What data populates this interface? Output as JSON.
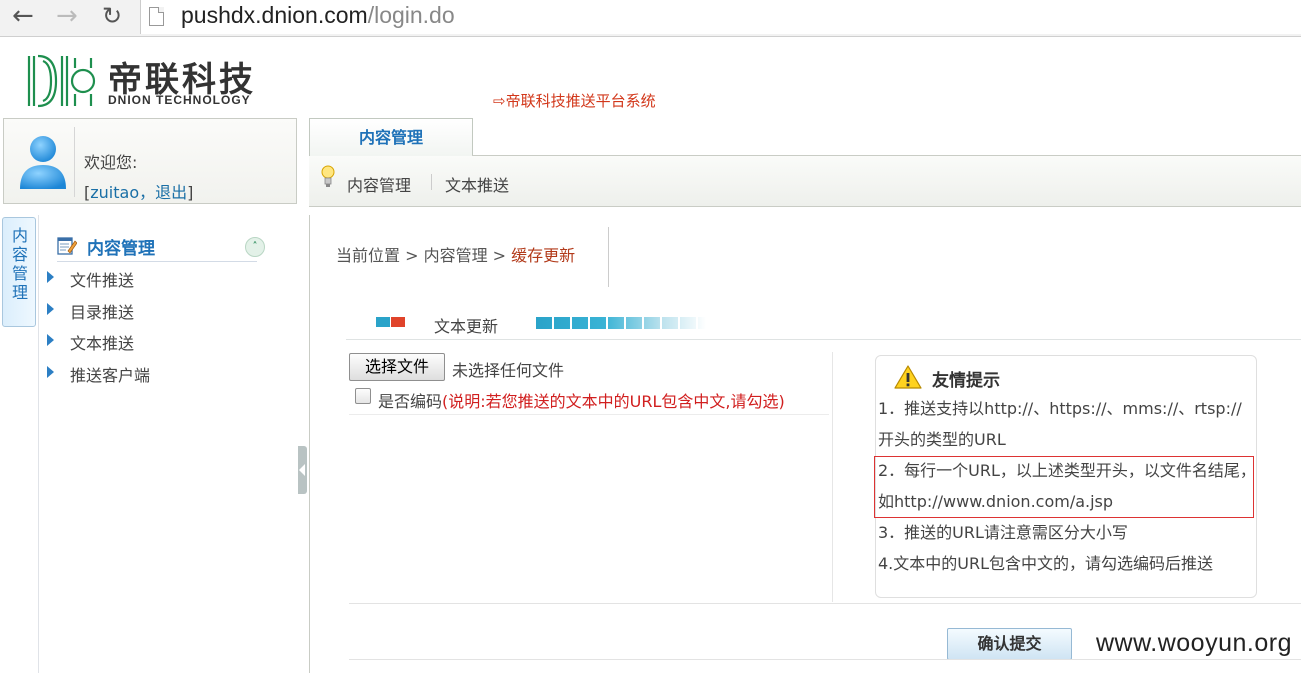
{
  "browser": {
    "back_glyph": "←",
    "forward_glyph": "→",
    "reload_glyph": "↻",
    "url_host": "pushdx.dnion.com",
    "url_path": "/login.do"
  },
  "header": {
    "logo_cn": "帝联科技",
    "logo_en": "DNION TECHNOLOGY",
    "system_title": "⇨帝联科技推送平台系统"
  },
  "user": {
    "welcome": "欢迎您:",
    "open_bracket": "[",
    "username": "zuitao",
    "separator": "，",
    "logout": "退出",
    "close_bracket": "]"
  },
  "topnav": {
    "active_tab": "内容管理",
    "sub_items": [
      "内容管理",
      "文本推送"
    ]
  },
  "sidebar": {
    "vertical_tab": "内容管理",
    "tree_title": "内容管理",
    "collapse_glyph": "˄",
    "items": [
      "文件推送",
      "目录推送",
      "文本推送",
      "推送客户端"
    ]
  },
  "content": {
    "breadcrumb": {
      "prefix": "当前位置 > 内容管理 > ",
      "current": "缓存更新"
    },
    "section_title": "文本更新",
    "file_button": "选择文件",
    "file_status": "未选择任何文件",
    "encode_label": "是否编码",
    "encode_note": "(说明:若您推送的文本中的URL包含中文,请勾选)",
    "submit": "确认提交"
  },
  "tips": {
    "title": "友情提示",
    "line1": "1．推送支持以http://、https://、mms://、rtsp://开头的类型的URL",
    "line2": "2．每行一个URL，以上述类型开头，以文件名结尾，如http://www.dnion.com/a.jsp",
    "line3": "3．推送的URL请注意需区分大小写",
    "line4": "4.文本中的URL包含中文的，请勾选编码后推送"
  },
  "watermark": "www.wooyun.org",
  "colors": {
    "link_blue": "#1f72b8",
    "accent_red": "#d2371a",
    "highlight_border": "#dd3333"
  }
}
